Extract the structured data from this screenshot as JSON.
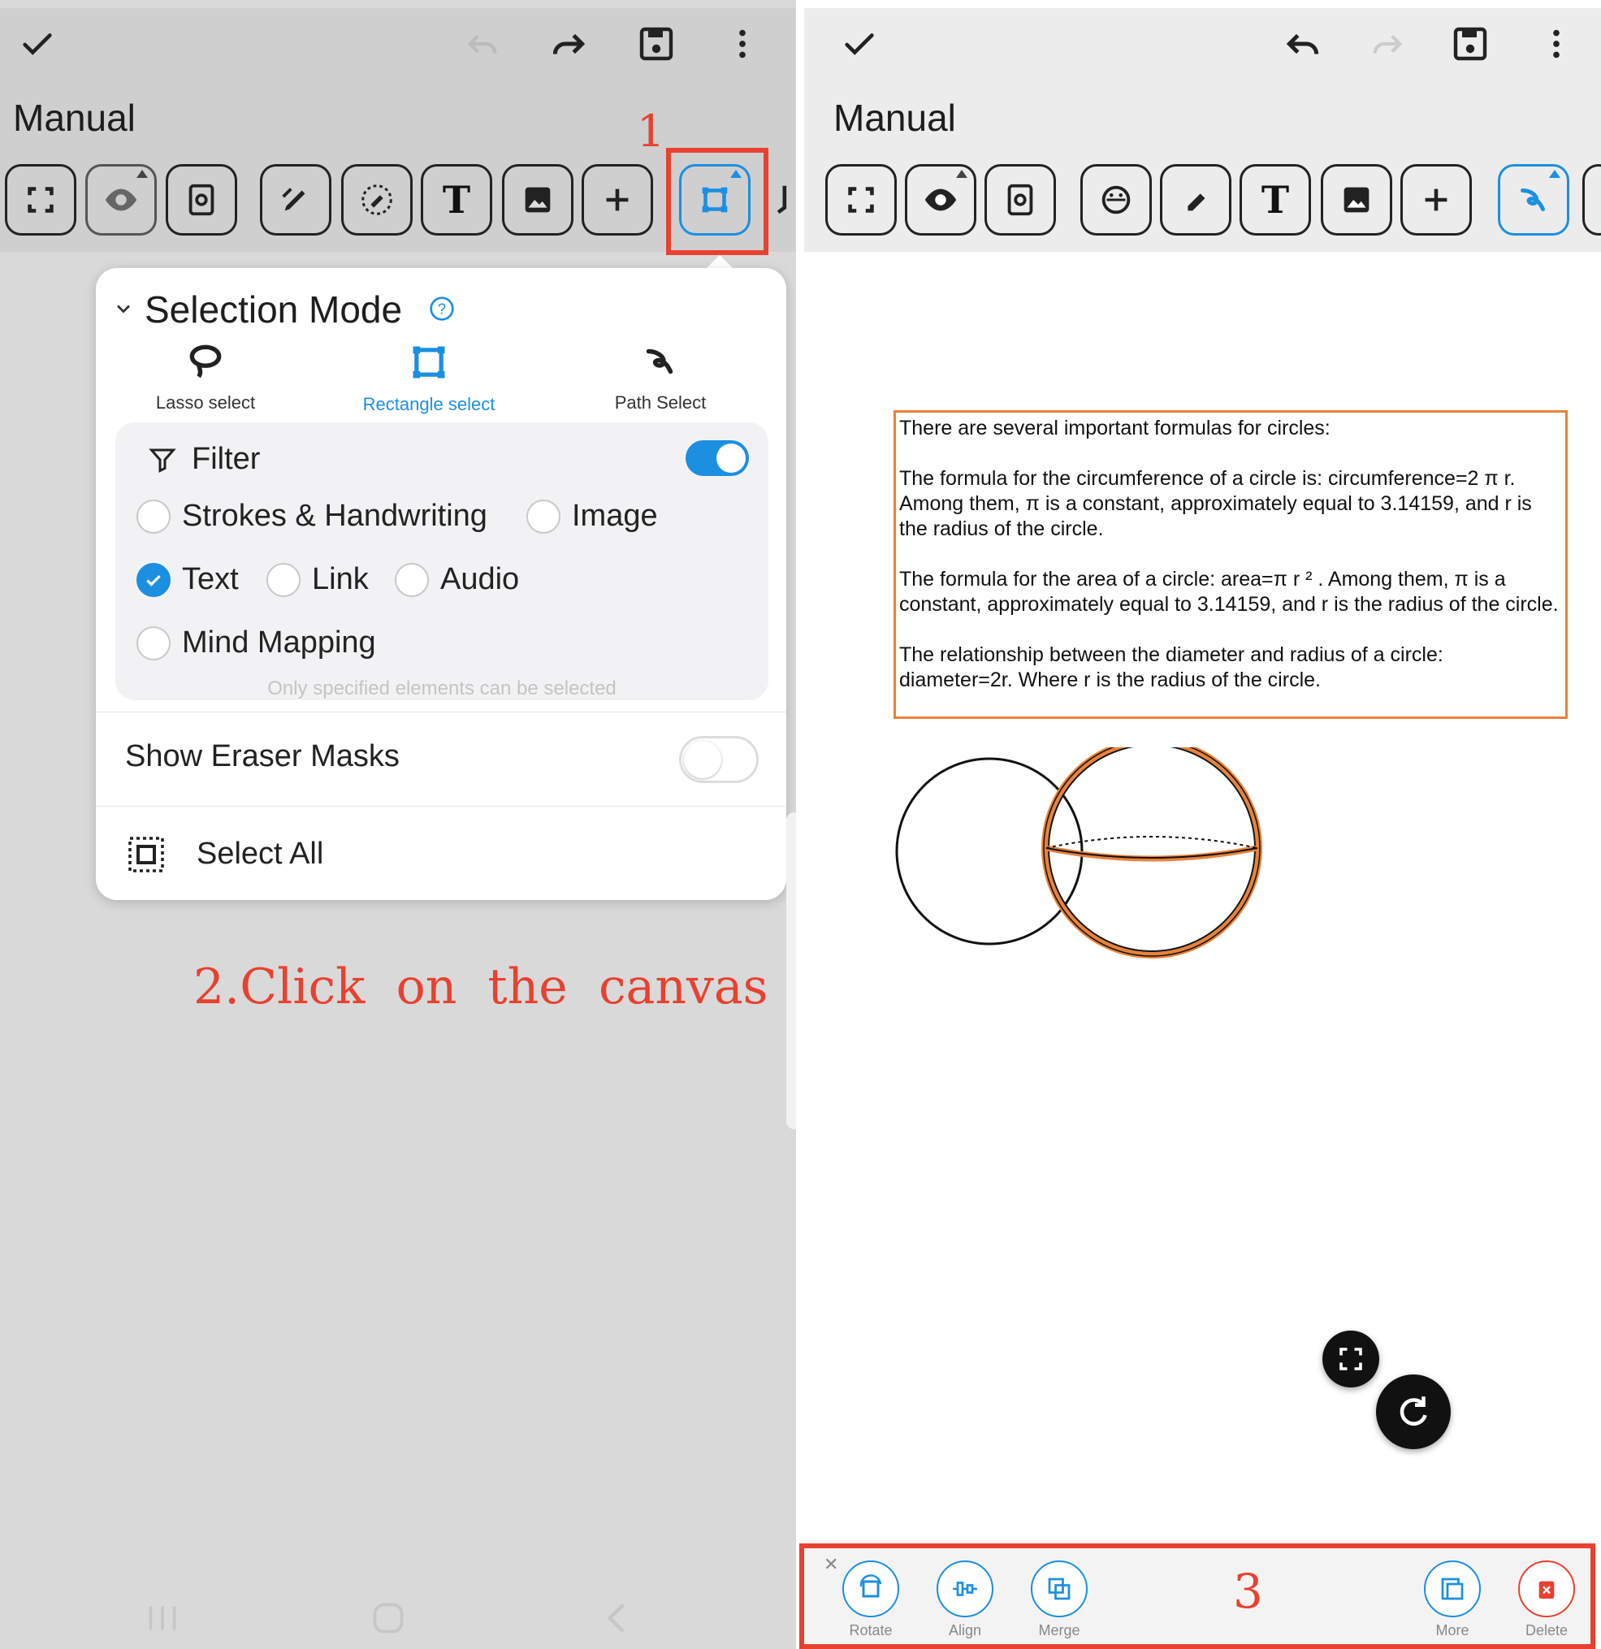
{
  "left_panel": {
    "title": "Manual",
    "step1_label": "1",
    "popup": {
      "title": "Selection Mode",
      "modes": [
        {
          "label": "Lasso select",
          "icon": "lasso-icon",
          "active": false
        },
        {
          "label": "Rectangle select",
          "icon": "rectangle-select-icon",
          "active": true
        },
        {
          "label": "Path Select",
          "icon": "path-select-icon",
          "active": false
        }
      ],
      "filter": {
        "label": "Filter",
        "enabled": true,
        "options": [
          {
            "label": "Strokes & Handwriting",
            "checked": false
          },
          {
            "label": "Image",
            "checked": false
          },
          {
            "label": "Text",
            "checked": true
          },
          {
            "label": "Link",
            "checked": false
          },
          {
            "label": "Audio",
            "checked": false
          },
          {
            "label": "Mind Mapping",
            "checked": false
          }
        ],
        "hint": "Only specified elements can be selected"
      },
      "show_eraser_masks": {
        "label": "Show Eraser Masks",
        "enabled": false
      },
      "select_all_label": "Select All"
    },
    "step2_label": "2.Click  on  the  canvas"
  },
  "right_panel": {
    "title": "Manual",
    "canvas_text": {
      "p1": "There are several important formulas for circles:",
      "p2": "The formula for the circumference of a circle is: circumference=2 π r. Among them, π is a constant, approximately equal to 3.14159, and r is the radius of the circle.",
      "p3": "The formula for the area of a circle: area=π r ² .   Among them, π is a constant, approximately equal to 3.14159, and r is the radius of the circle.",
      "p4": "The relationship between the diameter and radius of a circle: diameter=2r. Where r is the radius of the circle."
    },
    "step3_label": "3",
    "bottom_actions": [
      {
        "label": "Rotate",
        "icon": "rotate-icon"
      },
      {
        "label": "Align",
        "icon": "align-icon"
      },
      {
        "label": "Merge",
        "icon": "merge-icon"
      },
      {
        "label": "More",
        "icon": "more-icon"
      },
      {
        "label": "Delete",
        "icon": "delete-icon"
      }
    ]
  },
  "colors": {
    "accent": "#1c8fe0",
    "annotation_red": "#e8412f",
    "selection_orange": "#e8823a"
  }
}
